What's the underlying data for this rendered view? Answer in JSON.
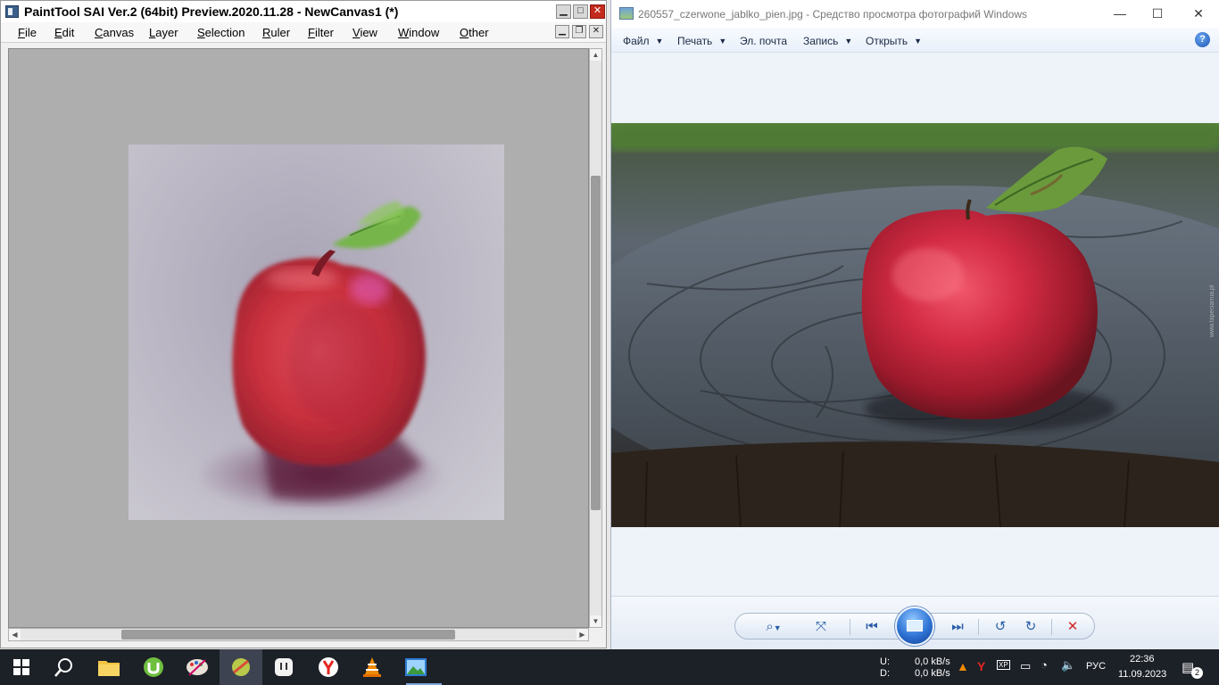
{
  "sai": {
    "title": "PaintTool SAI Ver.2 (64bit) Preview.2020.11.28 - NewCanvas1 (*)",
    "menu": [
      "File",
      "Edit",
      "Canvas",
      "Layer",
      "Selection",
      "Ruler",
      "Filter",
      "View",
      "Window",
      "Other"
    ],
    "window_buttons": {
      "minimize": "▁",
      "maximize": "□",
      "close": "✕"
    },
    "mdi_buttons": {
      "minimize": "▁",
      "restore": "❐",
      "close": "✕"
    }
  },
  "viewer": {
    "title": "260557_czerwone_jablko_pien.jpg - Средство просмотра фотографий Windows",
    "menu": [
      "Файл",
      "Печать",
      "Эл. почта",
      "Запись",
      "Открыть"
    ],
    "menu_has_caret": [
      true,
      true,
      false,
      true,
      true
    ],
    "help": "?",
    "window_buttons": {
      "minimize": "—",
      "maximize": "☐",
      "close": "✕"
    },
    "controls": {
      "zoom": "⌕",
      "fit": "⤧",
      "prev": "⏮",
      "next": "⏭",
      "rotate_ccw": "↺",
      "rotate_cw": "↻",
      "delete": "✕"
    },
    "watermark": "www.tapeciarnia.pl"
  },
  "taskbar": {
    "net_up_label": "U:",
    "net_down_label": "D:",
    "net_up": "0,0 kB/s",
    "net_down": "0,0 kB/s",
    "language": "РУС",
    "time": "22:36",
    "date": "11.09.2023",
    "notifications": "2"
  },
  "colors": {
    "sai_close": "#c42b1c",
    "viewer_accent": "#2d72d4",
    "delete_red": "#d22b2b",
    "taskbar": "#1c2027"
  }
}
